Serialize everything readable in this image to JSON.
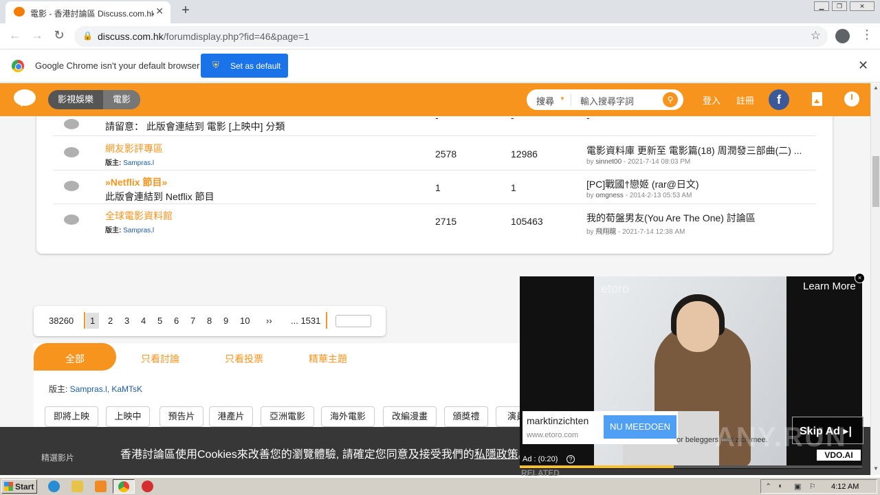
{
  "browser": {
    "tab_title": "電影 - 香港討論區 Discuss.com.hk - ",
    "url_host": "discuss.com.hk",
    "url_path": "/forumdisplay.php?fid=46&page=1",
    "infobar_message": "Google Chrome isn't your default browser",
    "set_default_label": "Set as default"
  },
  "site": {
    "breadcrumbs": [
      "影視娛樂",
      "電影"
    ],
    "search_scope": "搜尋",
    "search_placeholder": "輸入搜尋字詞",
    "login": "登入",
    "register": "註冊",
    "facebook_letter": "f",
    "accent_color": "#f7941d"
  },
  "forums": [
    {
      "name": "",
      "desc": "請留意： 此版會連結到 電影 [上映中] 分類",
      "moderator_prefix": "",
      "moderator": "",
      "topics": "-",
      "posts": "-",
      "last_title": "-",
      "last_user": "",
      "last_time": ""
    },
    {
      "name": "網友影評專區",
      "desc": "",
      "moderator_prefix": "版主: ",
      "moderator": "Sampras.l",
      "topics": "2578",
      "posts": "12986",
      "last_title": "電影資料庫 更新至 電影篇(18) 周潤發三部曲(二) ...",
      "last_user": "sinnet00",
      "last_time": " - 2021-7-14 08:03 PM"
    },
    {
      "name": "»Netflix 節目»",
      "desc": "此版會連結到 Netflix 節目",
      "moderator_prefix": "",
      "moderator": "",
      "topics": "1",
      "posts": "1",
      "last_title": "[PC]戰國†戀姬 (rar@日文)",
      "last_user": "omgness",
      "last_time": " - 2014-2-13 05:53 AM"
    },
    {
      "name": "全球電影資料館",
      "desc": "",
      "moderator_prefix": "版主: ",
      "moderator": "Sampras.l",
      "topics": "2715",
      "posts": "105463",
      "last_title": "我的荀盤男友(You Are The One) 討論區",
      "last_user": "飛翔龍",
      "last_time": " - 2021-7-14 12:38 AM"
    }
  ],
  "pager": {
    "total": "38260",
    "pages": [
      "1",
      "2",
      "3",
      "4",
      "5",
      "6",
      "7",
      "8",
      "9",
      "10",
      "››",
      "... 1531"
    ],
    "current": "1"
  },
  "filter_tabs": [
    "全部",
    "只看討論",
    "只看投票",
    "精華主題"
  ],
  "moderators": {
    "prefix": "版主: ",
    "names": "Sampras.l, KaMTsK"
  },
  "categories": [
    "即將上映",
    "上映中",
    "預告片",
    "港產片",
    "亞洲電影",
    "海外電影",
    "改編漫畫",
    "頒獎禮",
    "演員"
  ],
  "cookie": {
    "text": "香港討論區使用Cookies來改善您的瀏覽體驗, 請確定您同意及接受我們的",
    "link": "私隱政策",
    "end": "。",
    "behind_label": "精選影片"
  },
  "ad": {
    "watermark": "etoro",
    "learn_more": "Learn More",
    "close": "×",
    "brand": "marktinzichten",
    "brand_url": "www.etoro.com",
    "cta": "NU MEEDOEN",
    "disclaimer": "or beleggers met zich mee.",
    "skip": "Skip Ad ▸|",
    "vdo": "VDO.AI",
    "time": "Ad : (0:20)",
    "info": "?",
    "progress": 0.45,
    "related": "RELATED"
  },
  "overlay_watermark": "ANY.RUN",
  "taskbar": {
    "start": "Start",
    "time": "4:12 AM"
  }
}
